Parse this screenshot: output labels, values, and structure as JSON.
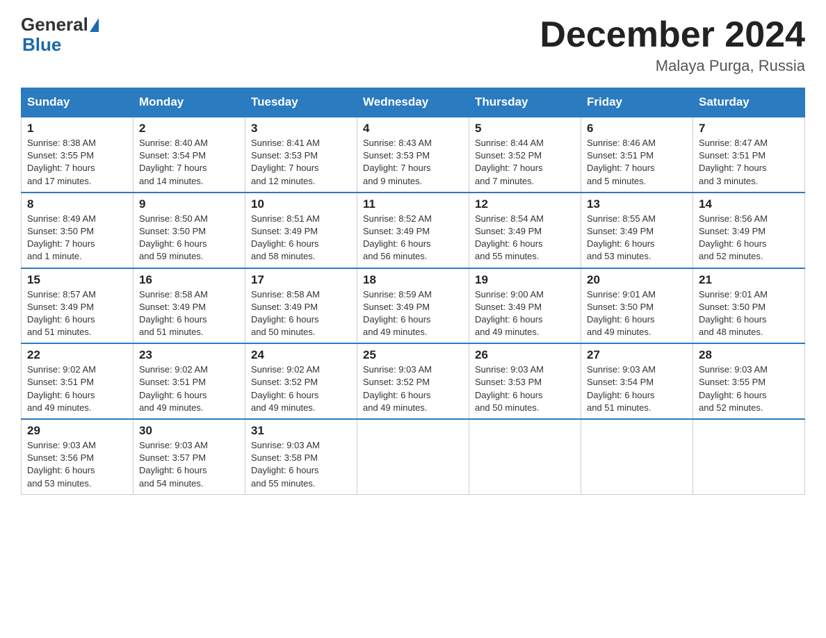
{
  "header": {
    "logo_general": "General",
    "logo_blue": "Blue",
    "month_title": "December 2024",
    "location": "Malaya Purga, Russia"
  },
  "columns": [
    "Sunday",
    "Monday",
    "Tuesday",
    "Wednesday",
    "Thursday",
    "Friday",
    "Saturday"
  ],
  "weeks": [
    [
      {
        "day": "1",
        "info": "Sunrise: 8:38 AM\nSunset: 3:55 PM\nDaylight: 7 hours\nand 17 minutes."
      },
      {
        "day": "2",
        "info": "Sunrise: 8:40 AM\nSunset: 3:54 PM\nDaylight: 7 hours\nand 14 minutes."
      },
      {
        "day": "3",
        "info": "Sunrise: 8:41 AM\nSunset: 3:53 PM\nDaylight: 7 hours\nand 12 minutes."
      },
      {
        "day": "4",
        "info": "Sunrise: 8:43 AM\nSunset: 3:53 PM\nDaylight: 7 hours\nand 9 minutes."
      },
      {
        "day": "5",
        "info": "Sunrise: 8:44 AM\nSunset: 3:52 PM\nDaylight: 7 hours\nand 7 minutes."
      },
      {
        "day": "6",
        "info": "Sunrise: 8:46 AM\nSunset: 3:51 PM\nDaylight: 7 hours\nand 5 minutes."
      },
      {
        "day": "7",
        "info": "Sunrise: 8:47 AM\nSunset: 3:51 PM\nDaylight: 7 hours\nand 3 minutes."
      }
    ],
    [
      {
        "day": "8",
        "info": "Sunrise: 8:49 AM\nSunset: 3:50 PM\nDaylight: 7 hours\nand 1 minute."
      },
      {
        "day": "9",
        "info": "Sunrise: 8:50 AM\nSunset: 3:50 PM\nDaylight: 6 hours\nand 59 minutes."
      },
      {
        "day": "10",
        "info": "Sunrise: 8:51 AM\nSunset: 3:49 PM\nDaylight: 6 hours\nand 58 minutes."
      },
      {
        "day": "11",
        "info": "Sunrise: 8:52 AM\nSunset: 3:49 PM\nDaylight: 6 hours\nand 56 minutes."
      },
      {
        "day": "12",
        "info": "Sunrise: 8:54 AM\nSunset: 3:49 PM\nDaylight: 6 hours\nand 55 minutes."
      },
      {
        "day": "13",
        "info": "Sunrise: 8:55 AM\nSunset: 3:49 PM\nDaylight: 6 hours\nand 53 minutes."
      },
      {
        "day": "14",
        "info": "Sunrise: 8:56 AM\nSunset: 3:49 PM\nDaylight: 6 hours\nand 52 minutes."
      }
    ],
    [
      {
        "day": "15",
        "info": "Sunrise: 8:57 AM\nSunset: 3:49 PM\nDaylight: 6 hours\nand 51 minutes."
      },
      {
        "day": "16",
        "info": "Sunrise: 8:58 AM\nSunset: 3:49 PM\nDaylight: 6 hours\nand 51 minutes."
      },
      {
        "day": "17",
        "info": "Sunrise: 8:58 AM\nSunset: 3:49 PM\nDaylight: 6 hours\nand 50 minutes."
      },
      {
        "day": "18",
        "info": "Sunrise: 8:59 AM\nSunset: 3:49 PM\nDaylight: 6 hours\nand 49 minutes."
      },
      {
        "day": "19",
        "info": "Sunrise: 9:00 AM\nSunset: 3:49 PM\nDaylight: 6 hours\nand 49 minutes."
      },
      {
        "day": "20",
        "info": "Sunrise: 9:01 AM\nSunset: 3:50 PM\nDaylight: 6 hours\nand 49 minutes."
      },
      {
        "day": "21",
        "info": "Sunrise: 9:01 AM\nSunset: 3:50 PM\nDaylight: 6 hours\nand 48 minutes."
      }
    ],
    [
      {
        "day": "22",
        "info": "Sunrise: 9:02 AM\nSunset: 3:51 PM\nDaylight: 6 hours\nand 49 minutes."
      },
      {
        "day": "23",
        "info": "Sunrise: 9:02 AM\nSunset: 3:51 PM\nDaylight: 6 hours\nand 49 minutes."
      },
      {
        "day": "24",
        "info": "Sunrise: 9:02 AM\nSunset: 3:52 PM\nDaylight: 6 hours\nand 49 minutes."
      },
      {
        "day": "25",
        "info": "Sunrise: 9:03 AM\nSunset: 3:52 PM\nDaylight: 6 hours\nand 49 minutes."
      },
      {
        "day": "26",
        "info": "Sunrise: 9:03 AM\nSunset: 3:53 PM\nDaylight: 6 hours\nand 50 minutes."
      },
      {
        "day": "27",
        "info": "Sunrise: 9:03 AM\nSunset: 3:54 PM\nDaylight: 6 hours\nand 51 minutes."
      },
      {
        "day": "28",
        "info": "Sunrise: 9:03 AM\nSunset: 3:55 PM\nDaylight: 6 hours\nand 52 minutes."
      }
    ],
    [
      {
        "day": "29",
        "info": "Sunrise: 9:03 AM\nSunset: 3:56 PM\nDaylight: 6 hours\nand 53 minutes."
      },
      {
        "day": "30",
        "info": "Sunrise: 9:03 AM\nSunset: 3:57 PM\nDaylight: 6 hours\nand 54 minutes."
      },
      {
        "day": "31",
        "info": "Sunrise: 9:03 AM\nSunset: 3:58 PM\nDaylight: 6 hours\nand 55 minutes."
      },
      {
        "day": "",
        "info": ""
      },
      {
        "day": "",
        "info": ""
      },
      {
        "day": "",
        "info": ""
      },
      {
        "day": "",
        "info": ""
      }
    ]
  ]
}
